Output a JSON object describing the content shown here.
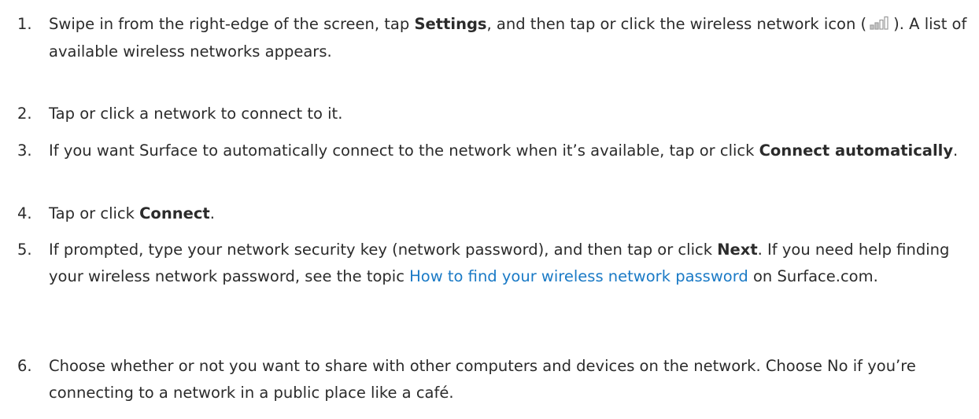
{
  "steps": [
    {
      "number": "1.",
      "text_a": "Swipe in from the right-edge of the screen, tap ",
      "bold_a": "Settings",
      "text_b": ", and then tap or click the wireless network icon (",
      "icon": "wireless-signal-icon",
      "text_c": "). A list of available wireless networks appears."
    },
    {
      "number": "2.",
      "text": "Tap or click a network to connect to it."
    },
    {
      "number": "3.",
      "text_a": "If you want Surface to automatically connect to the network when it’s available, tap or click ",
      "bold_a": "Connect automatically",
      "text_b": "."
    },
    {
      "number": "4.",
      "text_a": "Tap or click ",
      "bold_a": "Connect",
      "text_b": "."
    },
    {
      "number": "5.",
      "text_a": "If prompted, type your network security key (network password), and then tap or click ",
      "bold_a": "Next",
      "text_b": ". If you need help finding your wireless network password, see the topic ",
      "link": "How to find your wireless network password",
      "text_c": " on Surface.com."
    },
    {
      "number": "6.",
      "text": "Choose whether or not you want to share with other computers and devices on the network. Choose No if you’re connecting to a network in a public place like a café."
    }
  ],
  "colors": {
    "text": "#2b2b2b",
    "link": "#1a7ac6",
    "icon": "#9a9a9a"
  }
}
